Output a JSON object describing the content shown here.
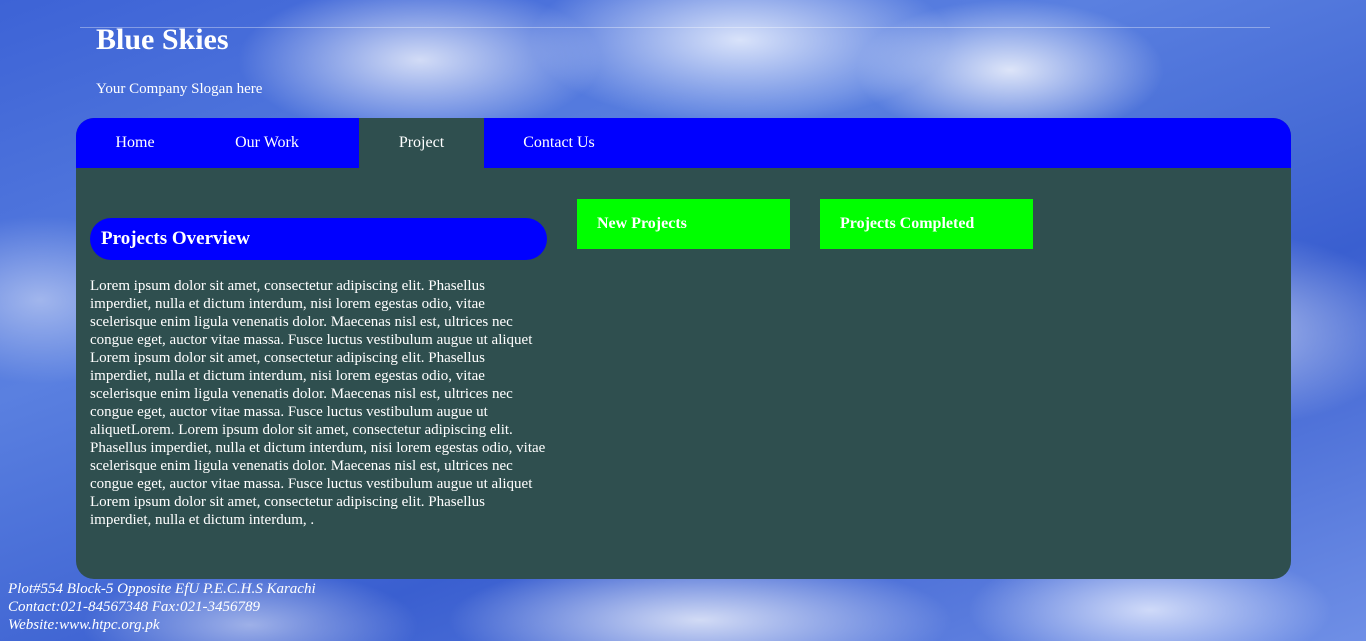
{
  "header": {
    "title": "Blue Skies",
    "slogan": "Your Company Slogan here"
  },
  "nav": {
    "items": [
      {
        "label": "Home"
      },
      {
        "label": "Our Work"
      },
      {
        "label": "Project",
        "active": true
      },
      {
        "label": "Contact Us"
      }
    ]
  },
  "main": {
    "overview_title": "Projects Overview",
    "overview_text": "Lorem ipsum dolor sit amet, consectetur adipiscing elit. Phasellus imperdiet, nulla et dictum interdum, nisi lorem egestas odio, vitae scelerisque enim ligula venenatis dolor. Maecenas nisl est, ultrices nec congue eget, auctor vitae massa. Fusce luctus vestibulum augue ut aliquet Lorem ipsum dolor sit amet, consectetur adipiscing elit. Phasellus imperdiet, nulla et dictum interdum, nisi lorem egestas odio, vitae scelerisque enim ligula venenatis dolor. Maecenas nisl est, ultrices nec congue eget, auctor vitae massa. Fusce luctus vestibulum augue ut aliquetLorem. Lorem ipsum dolor sit amet, consectetur adipiscing elit. Phasellus imperdiet, nulla et dictum interdum, nisi lorem egestas odio, vitae scelerisque enim ligula venenatis dolor. Maecenas nisl est, ultrices nec congue eget, auctor vitae massa. Fusce luctus vestibulum augue ut aliquet Lorem ipsum dolor sit amet, consectetur adipiscing elit. Phasellus imperdiet, nulla et dictum interdum, .",
    "new_projects_label": "New Projects",
    "projects_completed_label": "Projects Completed"
  },
  "footer": {
    "address": "Plot#554 Block-5 Opposite EfU P.E.C.H.S Karachi",
    "contact": "Contact:021-84567348 Fax:021-3456789",
    "website": "Website:www.htpc.org.pk"
  },
  "colors": {
    "nav_background": "#0000ff",
    "content_background": "#2f4f4f",
    "accent_green": "#00ff00",
    "text": "#ffffff"
  }
}
